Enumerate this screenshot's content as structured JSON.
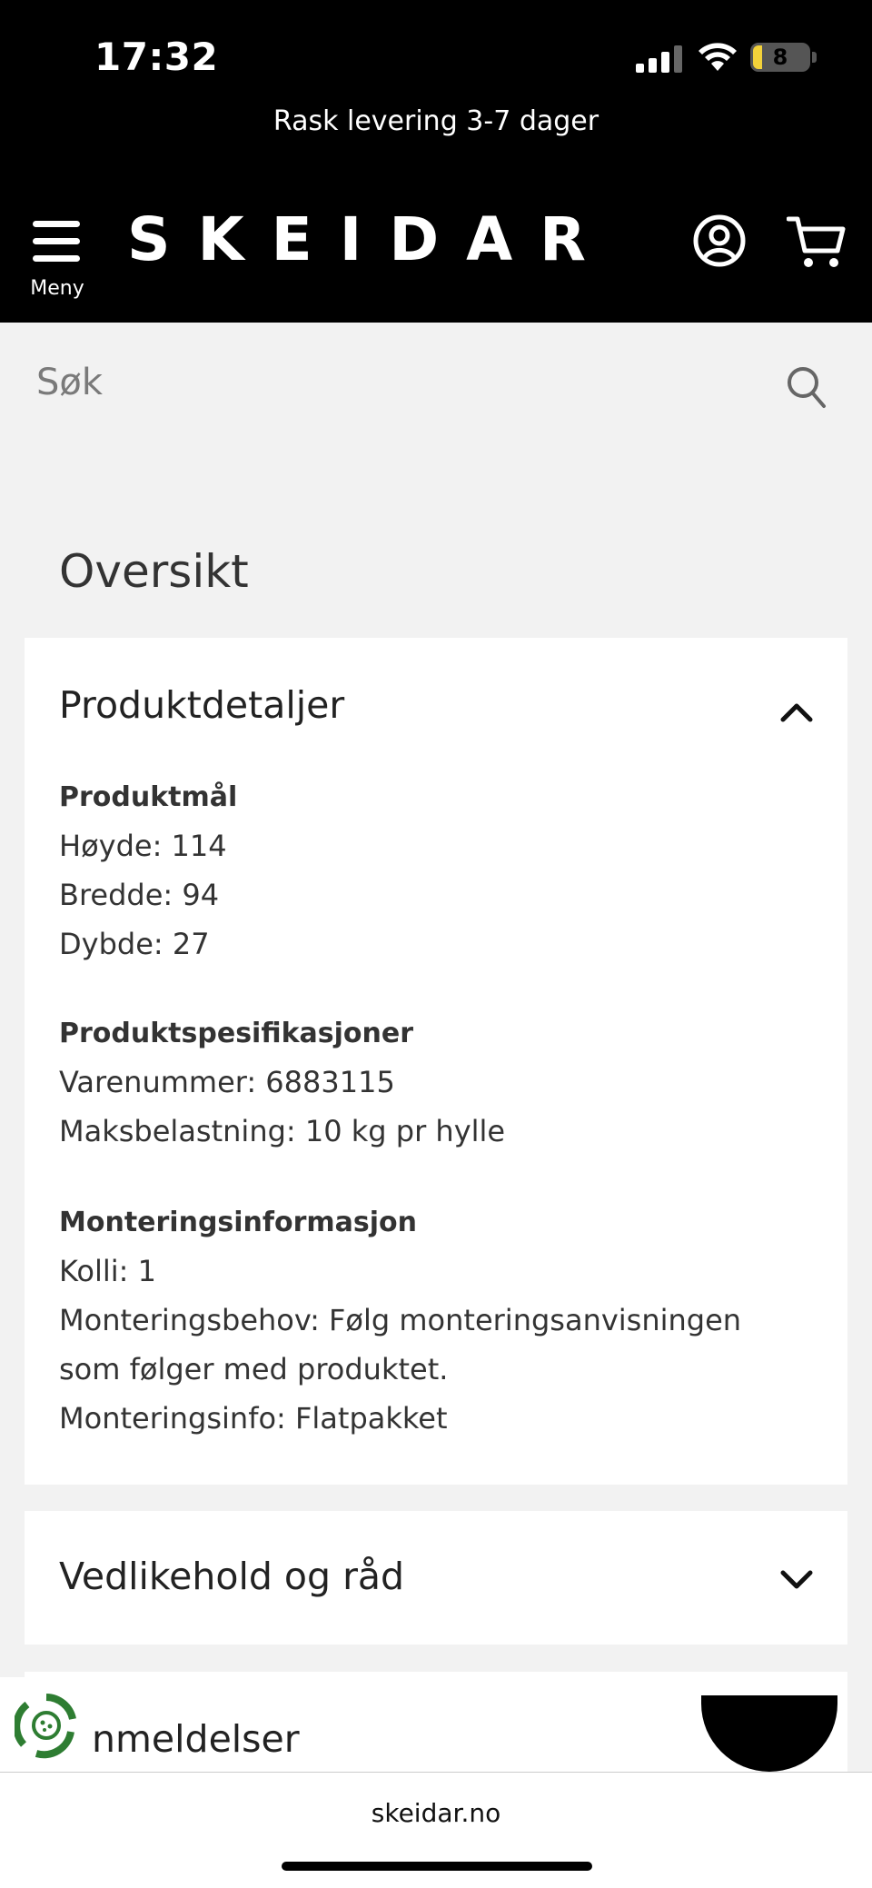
{
  "status_bar": {
    "time": "17:32",
    "battery": "8"
  },
  "header": {
    "promo": "Rask levering 3-7 dager",
    "menu_label": "Meny",
    "logo": "SKEIDAR"
  },
  "search": {
    "placeholder": "Søk"
  },
  "overview": {
    "title": "Oversikt",
    "sections": [
      {
        "title": "Produktdetaljer",
        "expanded": true,
        "groups": [
          {
            "heading": "Produktmål",
            "lines": [
              "Høyde: 114",
              "Bredde: 94",
              "Dybde: 27"
            ]
          },
          {
            "heading": "Produktspesifikasjoner",
            "lines": [
              "Varenummer: 6883115",
              "Maksbelastning: 10 kg pr hylle"
            ]
          },
          {
            "heading": "Monteringsinformasjon",
            "lines": [
              "Kolli: 1",
              "Monteringsbehov: Følg monteringsanvisningen",
              "som følger med produktet.",
              "Monteringsinfo: Flatpakket"
            ]
          }
        ]
      },
      {
        "title": "Vedlikehold og råd",
        "expanded": false
      },
      {
        "title": "nmeldelser",
        "expanded": false
      }
    ]
  },
  "browser": {
    "url": "skeidar.no"
  },
  "colors": {
    "header_bg": "#000000",
    "page_bg": "#f2f2f2",
    "eco_green": "#2e7d32",
    "battery_low": "#f3d23a"
  },
  "icons": [
    "signal-icon",
    "wifi-icon",
    "battery-icon",
    "hamburger-icon",
    "account-icon",
    "cart-icon",
    "search-icon",
    "chevron-up-icon",
    "chevron-down-icon",
    "eco-icon",
    "chat-icon"
  ]
}
